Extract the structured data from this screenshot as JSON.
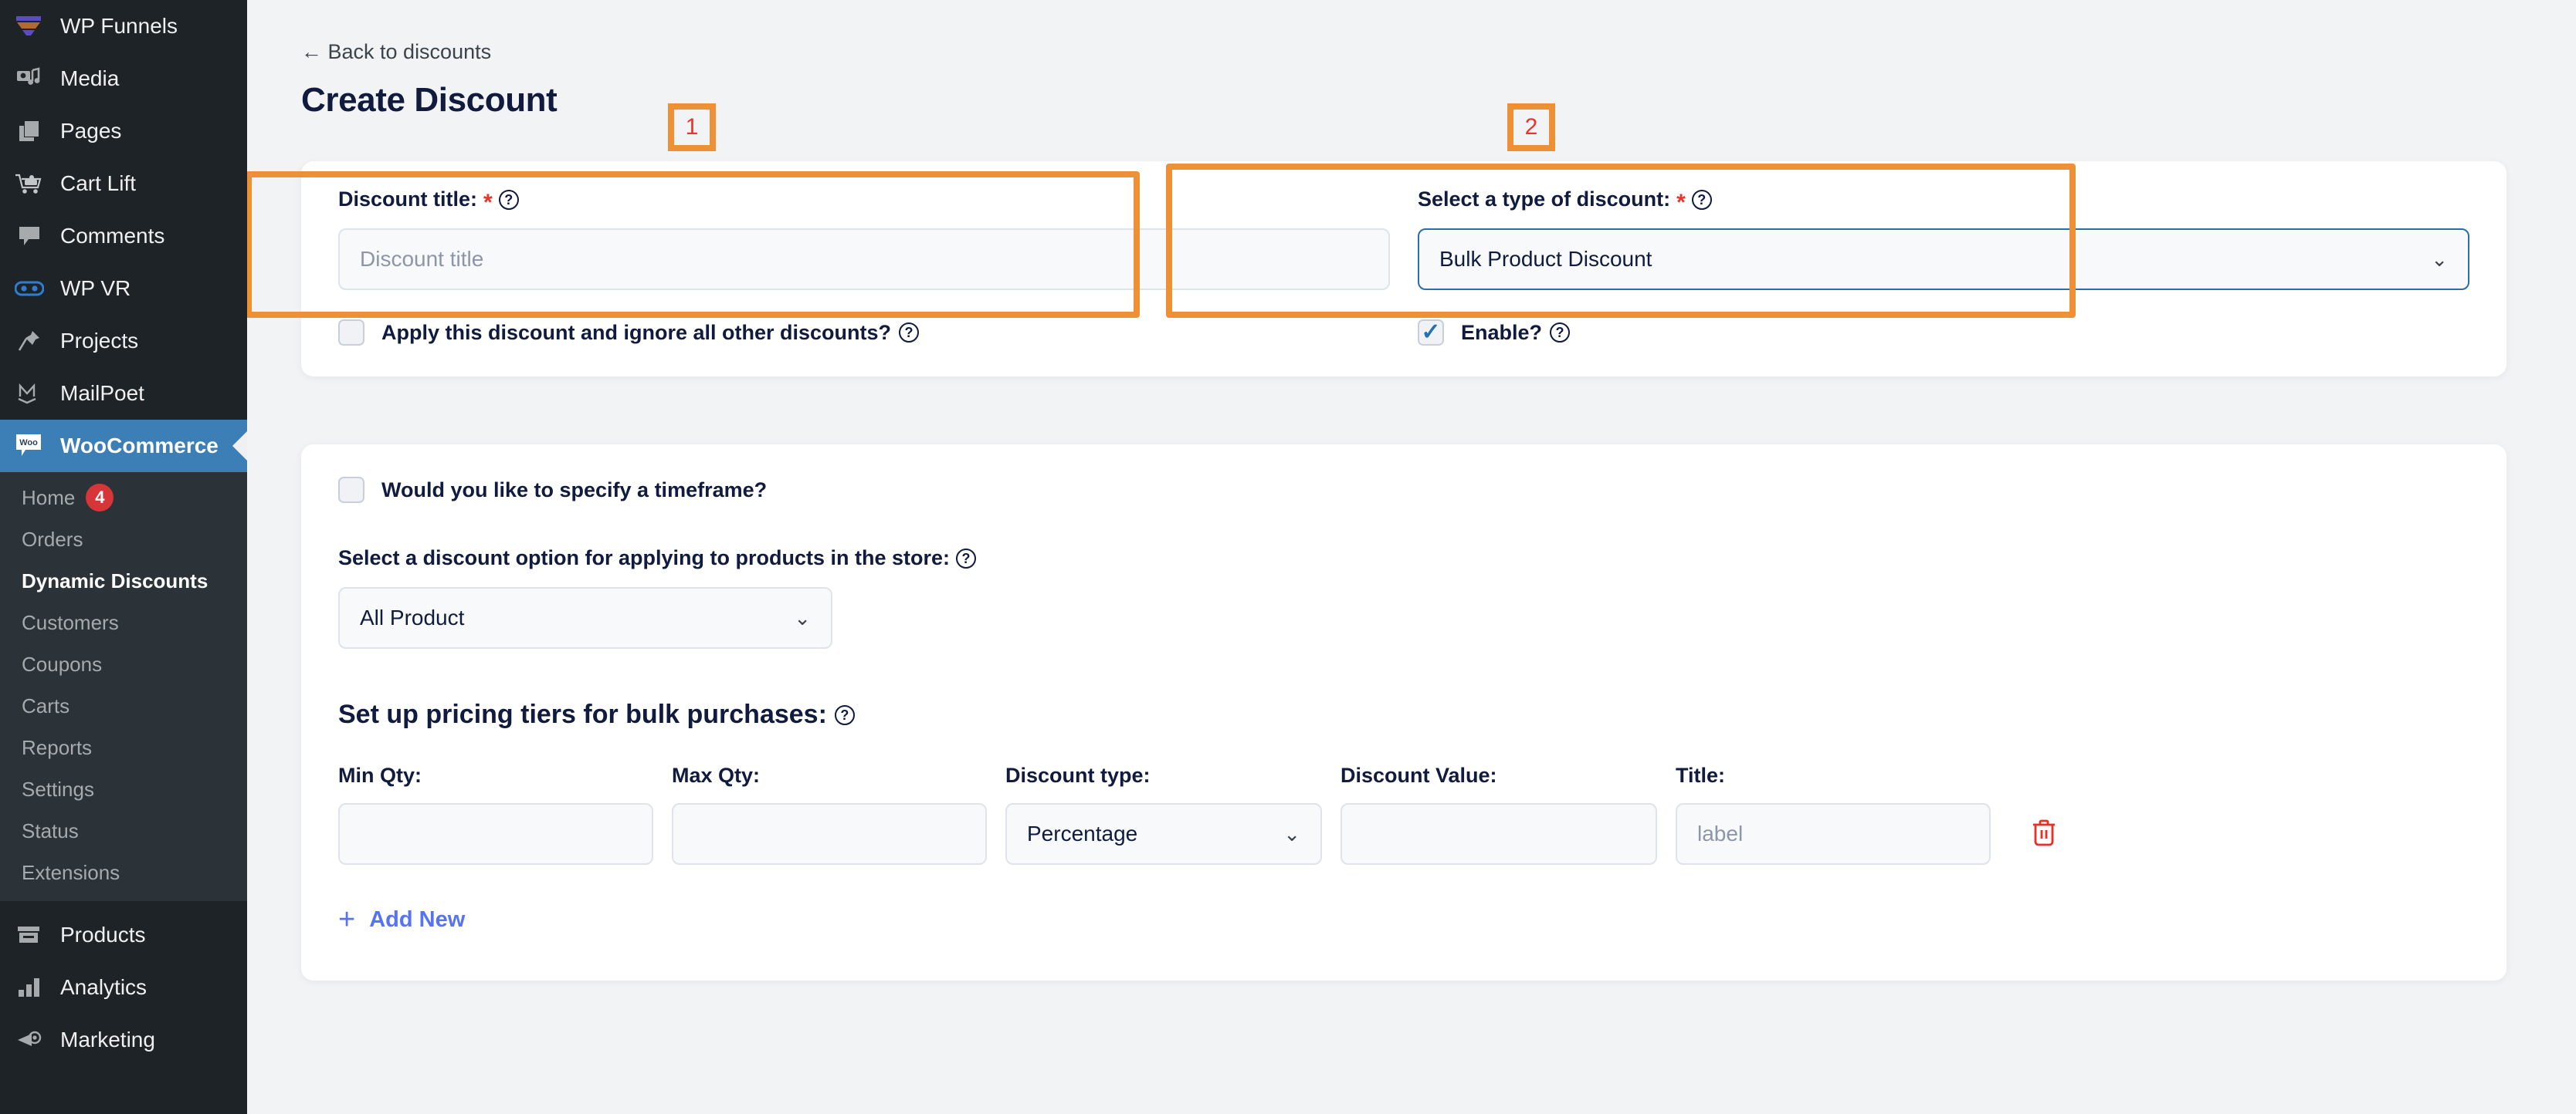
{
  "sidebar": {
    "items": [
      {
        "label": "WP Funnels",
        "icon": "funnel-icon",
        "active": false
      },
      {
        "label": "Media",
        "icon": "media-icon",
        "active": false
      },
      {
        "label": "Pages",
        "icon": "pages-icon",
        "active": false
      },
      {
        "label": "Cart Lift",
        "icon": "cart-lift-icon",
        "active": false
      },
      {
        "label": "Comments",
        "icon": "comments-icon",
        "active": false
      },
      {
        "label": "WP VR",
        "icon": "vr-goggles-icon",
        "active": false
      },
      {
        "label": "Projects",
        "icon": "pin-icon",
        "active": false
      },
      {
        "label": "MailPoet",
        "icon": "mailpoet-icon",
        "active": false
      },
      {
        "label": "WooCommerce",
        "icon": "woocommerce-icon",
        "active": true
      }
    ],
    "submenu": [
      {
        "label": "Home",
        "badge": "4",
        "current": false
      },
      {
        "label": "Orders",
        "badge": "",
        "current": false
      },
      {
        "label": "Dynamic Discounts",
        "badge": "",
        "current": true
      },
      {
        "label": "Customers",
        "badge": "",
        "current": false
      },
      {
        "label": "Coupons",
        "badge": "",
        "current": false
      },
      {
        "label": "Carts",
        "badge": "",
        "current": false
      },
      {
        "label": "Reports",
        "badge": "",
        "current": false
      },
      {
        "label": "Settings",
        "badge": "",
        "current": false
      },
      {
        "label": "Status",
        "badge": "",
        "current": false
      },
      {
        "label": "Extensions",
        "badge": "",
        "current": false
      }
    ],
    "bottom_items": [
      {
        "label": "Products",
        "icon": "products-icon"
      },
      {
        "label": "Analytics",
        "icon": "analytics-icon"
      },
      {
        "label": "Marketing",
        "icon": "megaphone-icon"
      }
    ]
  },
  "header": {
    "back_link": "← Back to discounts",
    "title": "Create Discount"
  },
  "general_card": {
    "discount_title": {
      "label": "Discount title:",
      "required_mark": "*",
      "info": "?",
      "value": "",
      "placeholder": "Discount title"
    },
    "discount_type": {
      "label": "Select a type of discount:",
      "required_mark": "*",
      "info": "?",
      "selected": "Bulk Product Discount",
      "chevron": "⌄",
      "options": [
        "Bulk Product Discount"
      ]
    },
    "ignore_others": {
      "label": "Apply this discount and ignore all other discounts?",
      "info": "?",
      "checked": false
    },
    "enable": {
      "label": "Enable?",
      "info": "?",
      "checked": true,
      "tick": "✓"
    }
  },
  "rules_card": {
    "timeframe": {
      "label": "Would you like to specify a timeframe?",
      "checked": false
    },
    "product_option": {
      "label": "Select a discount option for applying to products in the store:",
      "info": "?",
      "selected": "All Product",
      "chevron": "⌄",
      "options": [
        "All Product"
      ]
    },
    "tiers_heading": "Set up pricing tiers for bulk purchases:",
    "tiers_heading_info": "?",
    "columns": [
      "Min Qty:",
      "Max Qty:",
      "Discount type:",
      "Discount Value:",
      "Title:"
    ],
    "rows": [
      {
        "min_qty": "",
        "min_qty_placeholder": "",
        "max_qty": "",
        "max_qty_placeholder": "",
        "discount_type": "Percentage",
        "discount_type_chevron": "⌄",
        "discount_value": "",
        "discount_value_placeholder": "",
        "title": "",
        "title_placeholder": "label",
        "delete_icon": "trash-icon"
      }
    ],
    "add_new": {
      "plus": "+",
      "label": "Add New"
    }
  },
  "annotations": [
    {
      "number": "1"
    },
    {
      "number": "2"
    }
  ],
  "colors": {
    "accent_orange": "#ed9036",
    "annot_number_red": "#e8342a",
    "link_blue": "#5673f0",
    "sidebar_bg": "#1d2327",
    "active_blue": "#3c7fb6",
    "delete_red": "#ea2f24"
  }
}
